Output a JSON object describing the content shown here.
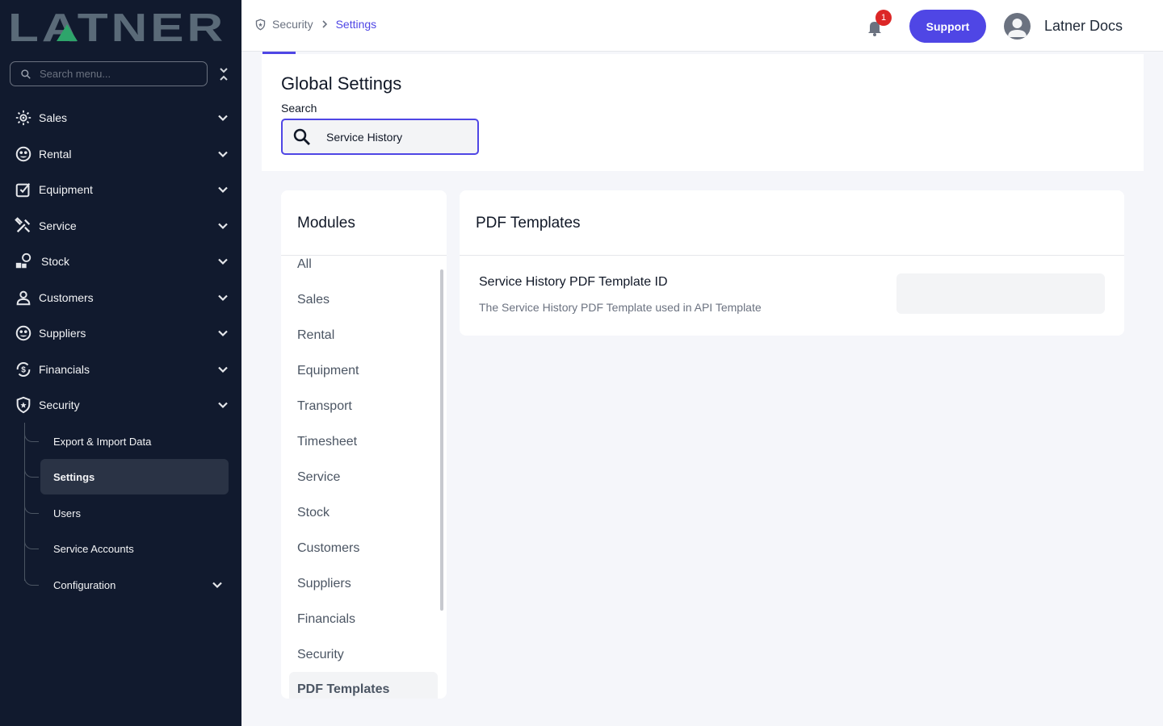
{
  "sidebar": {
    "logo_text": "LATNER",
    "search_placeholder": "Search menu...",
    "items": [
      {
        "label": "Sales",
        "icon": "sales-icon"
      },
      {
        "label": "Rental",
        "icon": "rental-icon"
      },
      {
        "label": "Equipment",
        "icon": "equipment-icon"
      },
      {
        "label": "Service",
        "icon": "service-icon"
      },
      {
        "label": "Stock",
        "icon": "stock-icon"
      },
      {
        "label": "Customers",
        "icon": "customers-icon"
      },
      {
        "label": "Suppliers",
        "icon": "suppliers-icon"
      },
      {
        "label": "Financials",
        "icon": "financials-icon"
      },
      {
        "label": "Security",
        "icon": "security-icon"
      }
    ],
    "security_sub": [
      {
        "label": "Export & Import Data"
      },
      {
        "label": "Settings"
      },
      {
        "label": "Users"
      },
      {
        "label": "Service Accounts"
      },
      {
        "label": "Configuration"
      }
    ],
    "active_sub": "Settings"
  },
  "header": {
    "breadcrumb": {
      "parent": "Security",
      "current": "Settings"
    },
    "notification_count": "1",
    "support_label": "Support",
    "user_name": "Latner Docs"
  },
  "main": {
    "title": "Global Settings",
    "search_label": "Search",
    "search_value": "Service History",
    "modules": {
      "title": "Modules",
      "items": [
        "All",
        "Sales",
        "Rental",
        "Equipment",
        "Transport",
        "Timesheet",
        "Service",
        "Stock",
        "Customers",
        "Suppliers",
        "Financials",
        "Security",
        "PDF Templates"
      ],
      "active": "PDF Templates"
    },
    "section": {
      "title": "PDF Templates",
      "setting_name": "Service History PDF Template ID",
      "setting_description": "The Service History PDF Template used in API Template",
      "setting_value": ""
    }
  },
  "colors": {
    "sidebar_bg": "#111a2e",
    "accent": "#4f46e5",
    "badge": "#dc2626",
    "logo_green": "#2ea56b",
    "logo_gray": "#5a6a78"
  }
}
